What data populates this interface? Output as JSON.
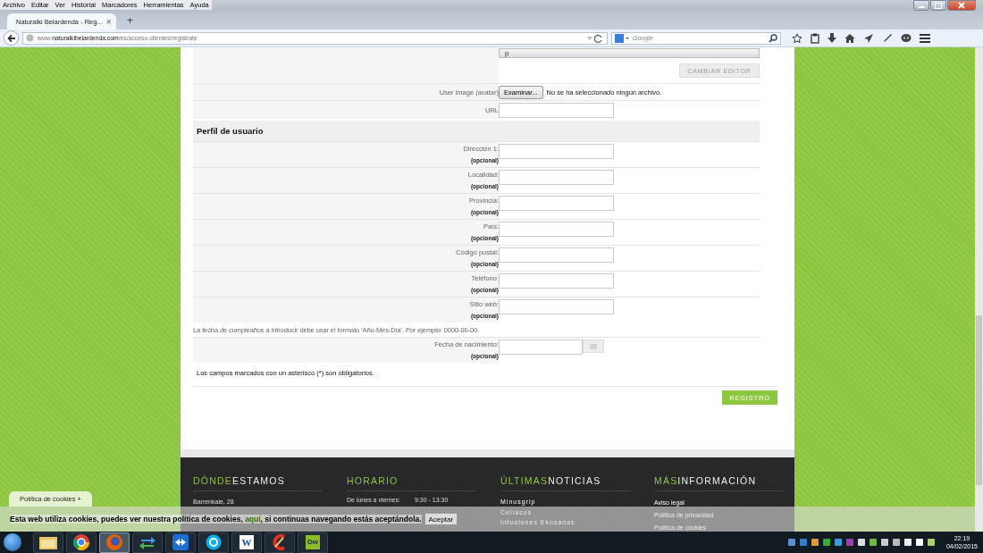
{
  "browser": {
    "menu": [
      "Archivo",
      "Editar",
      "Ver",
      "Historial",
      "Marcadores",
      "Herramientas",
      "Ayuda"
    ],
    "tab": {
      "title": "Naturalki Belardenda - Reg...",
      "close": "×",
      "selected": true
    },
    "new_tab": "+",
    "address": {
      "prefix": "www.",
      "host": "naturalkibelardenda.com",
      "path": "/es/acceso-clientes/registrate"
    },
    "search": {
      "placeholder": "Google"
    }
  },
  "form": {
    "textarea_value": "p",
    "editor_button": "CAMBIAR EDITOR",
    "avatar": {
      "label": "User image (avatar)",
      "button": "Examinar...",
      "status": "No se ha seleccionado ningún archivo."
    },
    "url": {
      "label": "URL"
    },
    "section_title": "Perfil de usuario",
    "fields": [
      {
        "label": "Dirección 1:",
        "note": "(opcional)"
      },
      {
        "label": "Localidad:",
        "note": "(opcional)"
      },
      {
        "label": "Provincia:",
        "note": "(opcional)"
      },
      {
        "label": "País:",
        "note": "(opcional)"
      },
      {
        "label": "Código postal:",
        "note": "(opcional)"
      },
      {
        "label": "Teléfono:",
        "note": "(opcional)"
      },
      {
        "label": "Sitio web:",
        "note": "(opcional)"
      }
    ],
    "birthday_hint": "La fecha de cumpleaños a introducir debe usar el formato 'Año-Mes-Día'. Por ejemplo: 0000-00-00.",
    "birthday": {
      "label": "Fecha de nacimiento:",
      "note": "(opcional)"
    },
    "required_note": "Los campos marcados con un asterisco (*) son obligatorios.",
    "submit": "REGISTRO"
  },
  "footer": {
    "columns": [
      {
        "kind": "lines",
        "title_accent": "DÓNDE",
        "title_rest": "ESTAMOS",
        "items": [
          "Barrenkale, 28"
        ]
      },
      {
        "kind": "pairs",
        "title_accent": "HORARIO",
        "items": [
          {
            "label": "De lunes a viernes:",
            "value": "9:30 - 13:30"
          }
        ]
      },
      {
        "kind": "news",
        "title_accent": "ÚLTIMAS",
        "title_rest": "NOTICIAS",
        "items": [
          "Minusgrip",
          "Celíacos",
          "Infusiones Ekosanas"
        ]
      },
      {
        "kind": "links",
        "title_accent": "MÁS",
        "title_rest": "INFORMACIÓN",
        "items": [
          "Aviso legal",
          "Política de privacidad",
          "Política de cookies"
        ]
      }
    ]
  },
  "cookies": {
    "tab": "Política de cookies +",
    "text_before": "Esta web utiliza cookies, puedes ver nuestra política de cookies, ",
    "link": "aquí",
    "text_after": ", si continuas navegando estás aceptándola.",
    "button": "Aceptar"
  },
  "taskbar": {
    "apps": [
      {
        "kind": "folder",
        "selected": false
      },
      {
        "kind": "chrome",
        "selected": false
      },
      {
        "kind": "firefox",
        "selected": true
      },
      {
        "kind": "transfer",
        "selected": false
      },
      {
        "kind": "remote",
        "selected": false
      },
      {
        "kind": "skype",
        "selected": false
      },
      {
        "kind": "word",
        "label": "W",
        "selected": false
      },
      {
        "kind": "cleaner",
        "selected": false
      },
      {
        "kind": "dreamweaver",
        "label": "Dw",
        "selected": false
      }
    ],
    "clock": "22:19",
    "date": "04/02/2015"
  }
}
